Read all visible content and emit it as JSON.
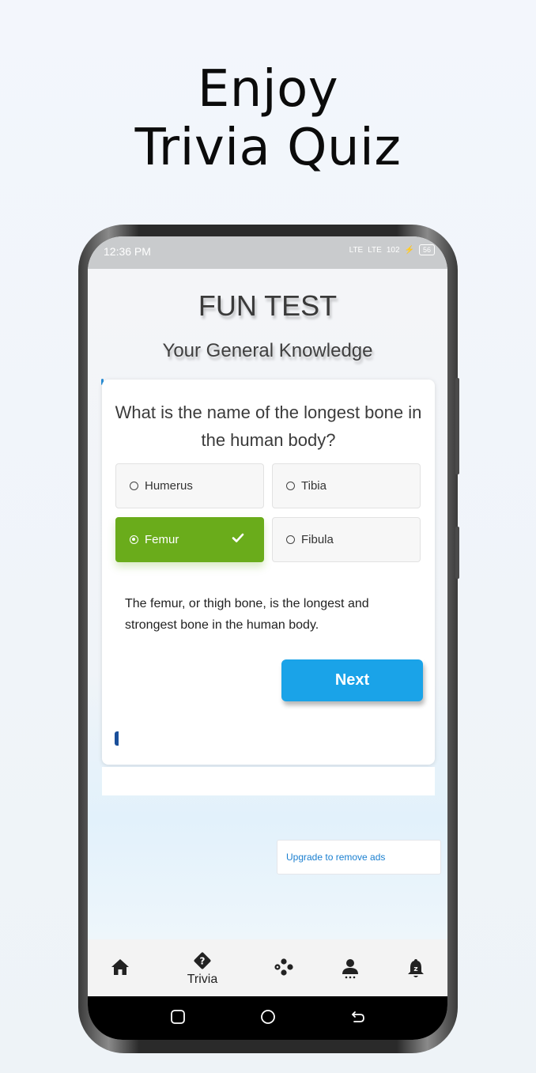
{
  "headline": {
    "line1": "Enjoy",
    "line2": "Trivia Quiz"
  },
  "statusbar": {
    "time": "12:36 PM",
    "signal1": "LTE",
    "signal2": "LTE",
    "data_rate": "102",
    "battery": "56"
  },
  "app": {
    "title": "FUN TEST",
    "subtitle": "Your General Knowledge"
  },
  "quiz": {
    "question": "What is the name of the longest bone in the human body?",
    "options": [
      {
        "label": "Humerus",
        "selected": false
      },
      {
        "label": "Tibia",
        "selected": false
      },
      {
        "label": "Femur",
        "selected": true
      },
      {
        "label": "Fibula",
        "selected": false
      }
    ],
    "explanation": "The femur, or thigh bone, is the longest and strongest bone in the human body.",
    "next_label": "Next"
  },
  "ads": {
    "upgrade_label": "Upgrade to remove ads"
  },
  "bottom_nav": {
    "items": [
      {
        "icon": "home-icon",
        "label": ""
      },
      {
        "icon": "trivia-icon",
        "label": "Trivia"
      },
      {
        "icon": "games-icon",
        "label": ""
      },
      {
        "icon": "profile-icon",
        "label": ""
      },
      {
        "icon": "notification-icon",
        "label": ""
      }
    ]
  },
  "colors": {
    "selected_option": "#6aac1b",
    "next_button": "#1aa3e8",
    "link": "#1a7fd0"
  }
}
